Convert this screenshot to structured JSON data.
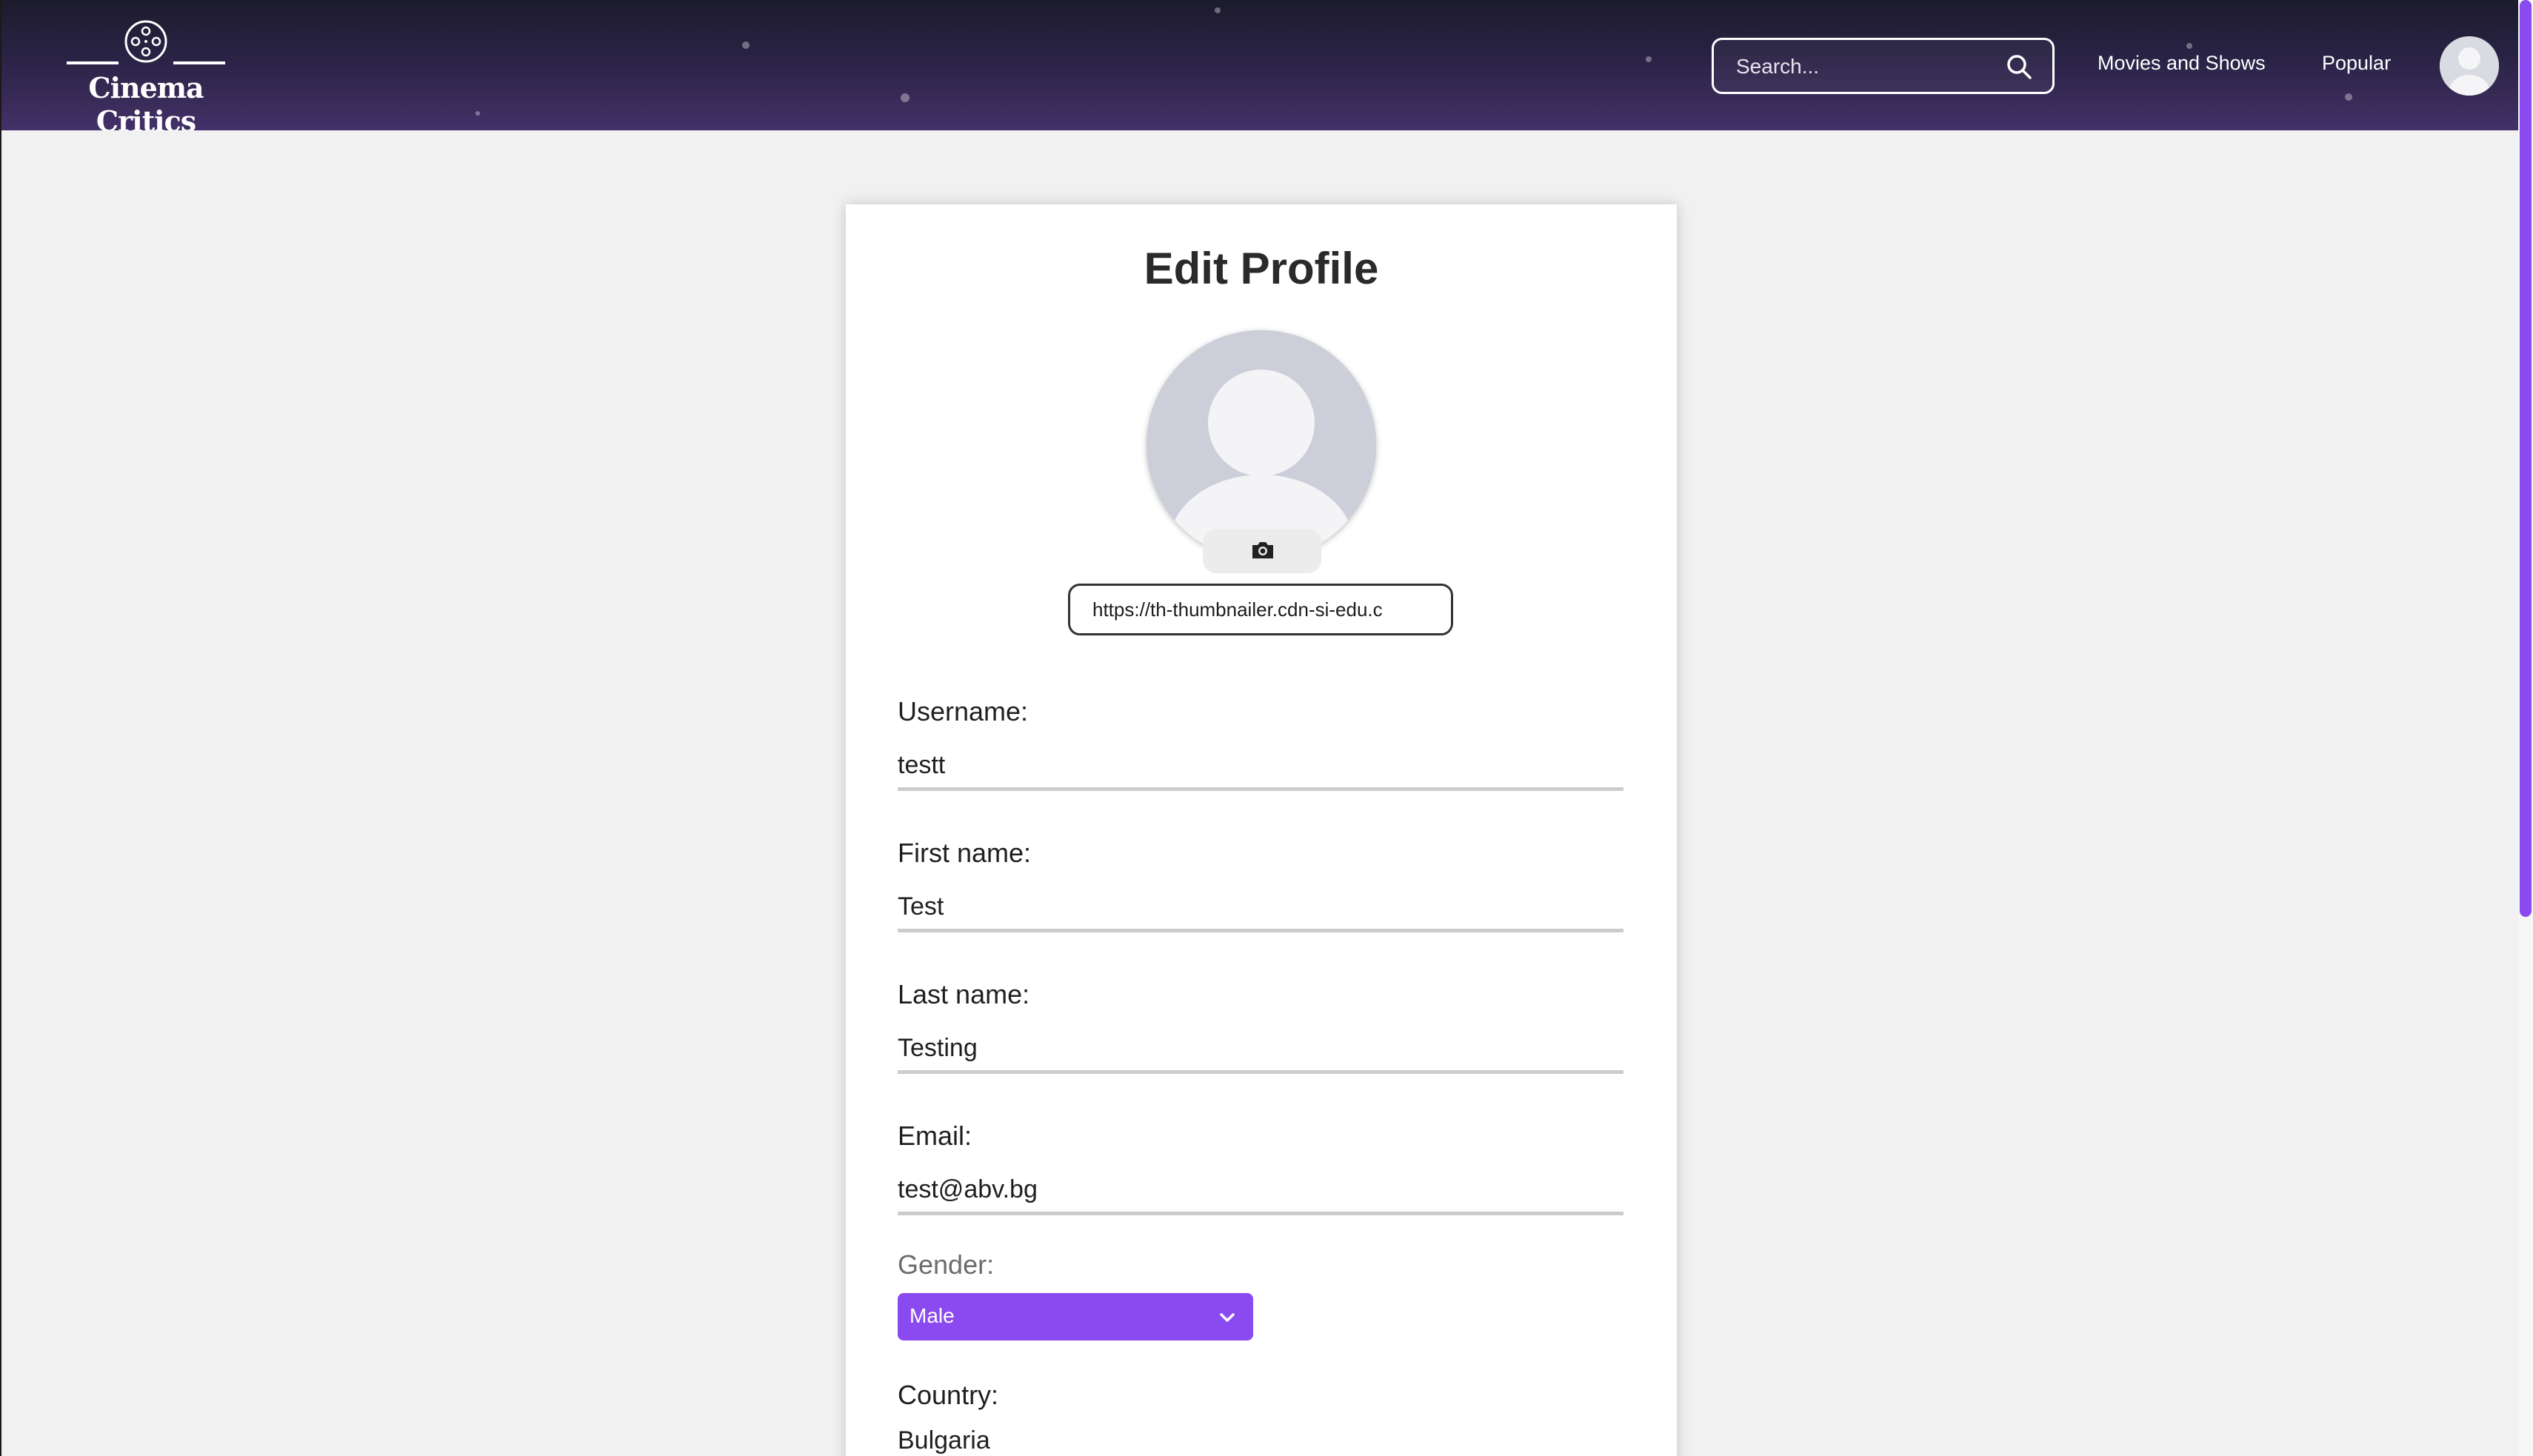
{
  "header": {
    "logo_text": "Cinema Critics",
    "search": {
      "placeholder": "Search..."
    },
    "nav": {
      "movies_and_shows": "Movies and Shows",
      "popular": "Popular"
    }
  },
  "profile_form": {
    "title": "Edit Profile",
    "image_url": "https://th-thumbnailer.cdn-si-edu.c",
    "fields": {
      "username": {
        "label": "Username:",
        "value": "testt"
      },
      "first_name": {
        "label": "First name:",
        "value": "Test"
      },
      "last_name": {
        "label": "Last name:",
        "value": "Testing"
      },
      "email": {
        "label": "Email:",
        "value": "test@abv.bg"
      }
    },
    "gender": {
      "label": "Gender:",
      "selected": "Male"
    },
    "country": {
      "label": "Country:",
      "value": "Bulgaria"
    }
  },
  "colors": {
    "accent": "#8a4af0",
    "header_top": "#1c1b2c",
    "header_bottom": "#43306a",
    "page_background": "#f1f1f1"
  },
  "icons": {
    "logo": "film-reel-icon",
    "search": "search-icon",
    "avatar": "user-avatar-icon",
    "camera": "camera-icon",
    "dropdown": "chevron-down-icon"
  }
}
